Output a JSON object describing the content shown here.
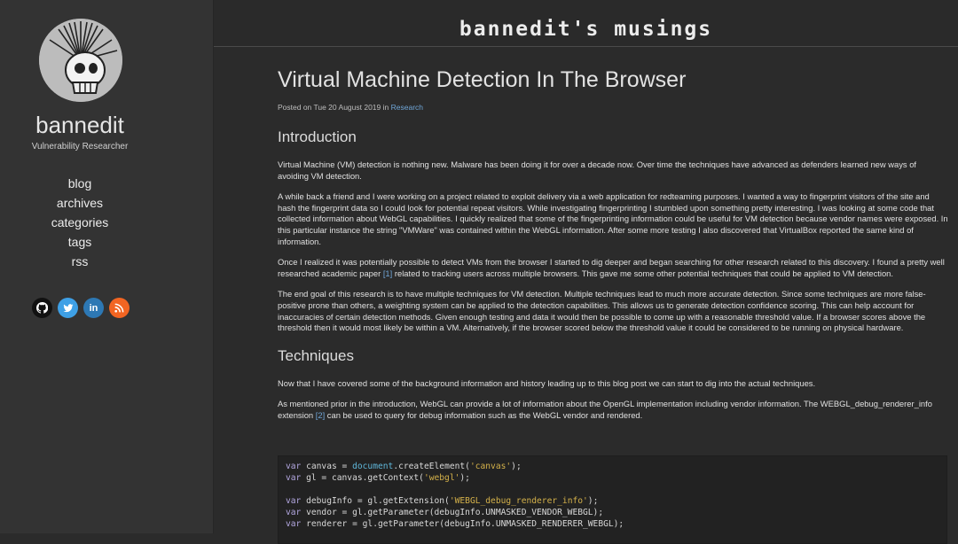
{
  "sidebar": {
    "site_name": "bannedit",
    "role": "Vulnerability Researcher",
    "nav": [
      "blog",
      "archives",
      "categories",
      "tags",
      "rss"
    ],
    "social": [
      {
        "name": "github-icon",
        "color": "#111111"
      },
      {
        "name": "twitter-icon",
        "color": "#3ea0e6"
      },
      {
        "name": "linkedin-icon",
        "color": "#2d78b4"
      },
      {
        "name": "rss-icon",
        "color": "#f26522"
      }
    ]
  },
  "header": {
    "title": "bannedit's musings"
  },
  "post": {
    "title": "Virtual Machine Detection In The Browser",
    "meta_prefix": "Posted on Tue 20 August 2019 in",
    "category": "Research",
    "intro_heading": "Introduction",
    "intro_p1": "Virtual Machine (VM) detection is nothing new. Malware has been doing it for over a decade now. Over time the techniques have advanced as defenders learned new ways of avoiding VM detection.",
    "intro_p2": "A while back a friend and I were working on a project related to exploit delivery via a web application for redteaming purposes. I wanted a way to fingerprint visitors of the site and hash the fingerprint data so I could look for potential repeat visitors. While investigating fingerprinting I stumbled upon something pretty interesting. I was looking at some code that collected information about WebGL capabilities. I quickly realized that some of the fingerprinting information could be useful for VM detection because vendor names were exposed. In this particular instance the string \"VMWare\" was contained within the WebGL information. After some more testing I also discovered that VirtualBox reported the same kind of information.",
    "intro_p3_a": "Once I realized it was potentially possible to detect VMs from the browser I started to dig deeper and began searching for other research related to this discovery. I found a pretty well researched academic paper",
    "intro_p3_ref": "[1]",
    "intro_p3_b": "related to tracking users across multiple browsers. This gave me some other potential techniques that could be applied to VM detection.",
    "intro_p4": "The end goal of this research is to have multiple techniques for VM detection. Multiple techniques lead to much more accurate detection. Since some techniques are more false-positive prone than others, a weighting system can be applied to the detection capabilities. This allows us to generate detection confidence scoring. This can help account for inaccuracies of certain detection methods. Given enough testing and data it would then be possible to come up with a reasonable threshold value. If a browser scores above the threshold then it would most likely be within a VM. Alternatively, if the browser scored below the threshold value it could be considered to be running on physical hardware.",
    "tech_heading": "Techniques",
    "tech_p1": "Now that I have covered some of the background information and history leading up to this blog post we can start to dig into the actual techniques.",
    "tech_p2_a": "As mentioned prior in the introduction, WebGL can provide a lot of information about the OpenGL implementation including vendor information. The WEBGL_debug_renderer_info extension",
    "tech_p2_ref": "[2]",
    "tech_p2_b": "can be used to query for debug information such as the WebGL vendor and rendered."
  },
  "code": {
    "l1_kw": "var",
    "l1_a": " canvas = ",
    "l1_obj": "document",
    "l1_b": ".createElement(",
    "l1_str": "'canvas'",
    "l1_c": ");",
    "l2_kw": "var",
    "l2_a": " gl = canvas.getContext(",
    "l2_str": "'webgl'",
    "l2_b": ");",
    "l3_kw": "var",
    "l3_a": " debugInfo = gl.getExtension(",
    "l3_str": "'WEBGL_debug_renderer_info'",
    "l3_b": ");",
    "l4_kw": "var",
    "l4_a": " vendor = gl.getParameter(debugInfo.UNMASKED_VENDOR_WEBGL);",
    "l5_kw": "var",
    "l5_a": " renderer = gl.getParameter(debugInfo.UNMASKED_RENDERER_WEBGL);"
  }
}
